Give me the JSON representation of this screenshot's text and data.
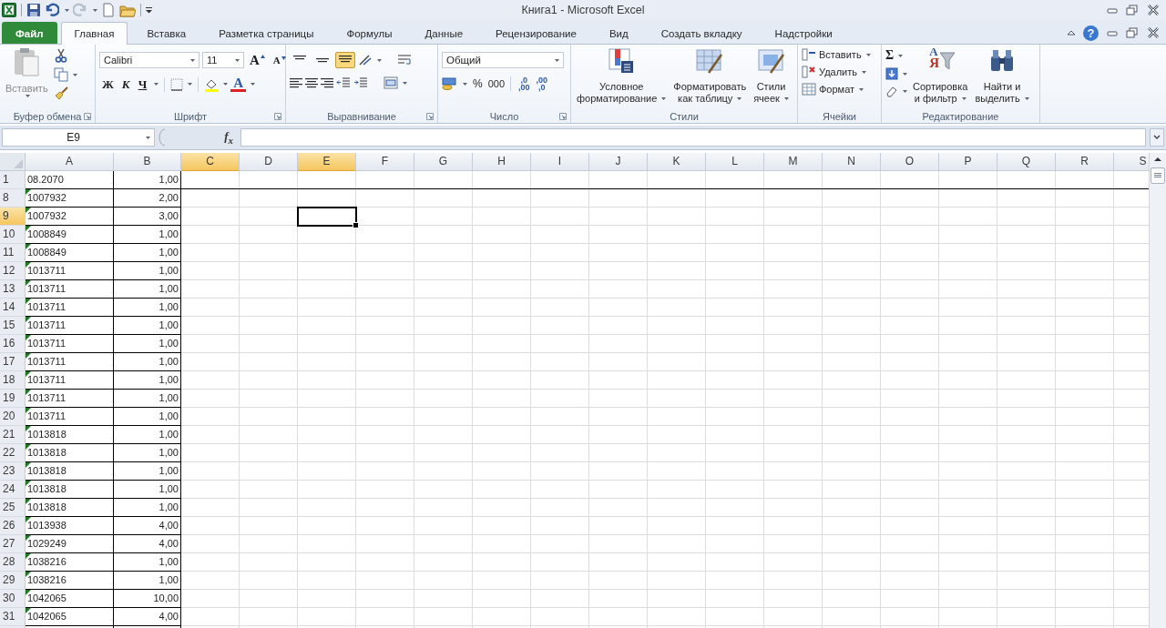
{
  "window": {
    "title": "Книга1  -  Microsoft Excel"
  },
  "tabs": [
    {
      "label": "Файл",
      "kind": "file",
      "selected": false
    },
    {
      "label": "Главная",
      "kind": "tab",
      "selected": true
    },
    {
      "label": "Вставка",
      "kind": "tab",
      "selected": false
    },
    {
      "label": "Разметка страницы",
      "kind": "tab",
      "selected": false
    },
    {
      "label": "Формулы",
      "kind": "tab",
      "selected": false
    },
    {
      "label": "Данные",
      "kind": "tab",
      "selected": false
    },
    {
      "label": "Рецензирование",
      "kind": "tab",
      "selected": false
    },
    {
      "label": "Вид",
      "kind": "tab",
      "selected": false
    },
    {
      "label": "Создать вкладку",
      "kind": "tab",
      "selected": false
    },
    {
      "label": "Надстройки",
      "kind": "tab",
      "selected": false
    }
  ],
  "help": {
    "glyph": "?"
  },
  "ribbon": [
    {
      "kind": "clipboard",
      "name": "Буфер обмена",
      "paste": "Вставить",
      "disabled": true
    },
    {
      "kind": "font",
      "name": "Шрифт",
      "font": "Calibri",
      "size": "11",
      "grow": "A",
      "shrink": "A",
      "bold": "Ж",
      "italic": "К",
      "underline": "Ч",
      "color_letter": "A"
    },
    {
      "kind": "alignment",
      "name": "Выравнивание",
      "vertical": [
        {
          "selected": false
        },
        {
          "selected": false
        },
        {
          "selected": true
        }
      ]
    },
    {
      "kind": "number",
      "name": "Число",
      "format": "Общий",
      "percent": "%",
      "thousands": "000",
      "increase_decimal": [
        ",0",
        ",00"
      ],
      "decrease_decimal": [
        ",00",
        ",0"
      ]
    },
    {
      "kind": "styles",
      "name": "Стили",
      "buttons": [
        {
          "lines": [
            "Условное",
            "форматирование"
          ]
        },
        {
          "lines": [
            "Форматировать",
            "как таблицу"
          ]
        },
        {
          "lines": [
            "Стили",
            "ячеек"
          ]
        }
      ]
    },
    {
      "kind": "cells",
      "name": "Ячейки",
      "buttons": [
        "Вставить",
        "Удалить",
        "Формат"
      ]
    },
    {
      "kind": "editing",
      "name": "Редактирование",
      "sum": "Σ",
      "sort_letters": [
        "A",
        "Я"
      ],
      "buttons": [
        {
          "lines": [
            "Сортировка",
            "и фильтр"
          ]
        },
        {
          "lines": [
            "Найти и",
            "выделить"
          ]
        }
      ]
    }
  ],
  "formula_bar": {
    "name_box": "E9",
    "fx": "f$_{x}$"
  },
  "columns": [
    {
      "label": "A",
      "selected": false,
      "active": false
    },
    {
      "label": "B",
      "selected": false,
      "active": false
    },
    {
      "label": "C",
      "selected": true,
      "active": false
    },
    {
      "label": "D",
      "selected": false,
      "active": false
    },
    {
      "label": "E",
      "selected": true,
      "active": true
    },
    {
      "label": "F",
      "selected": false,
      "active": false
    },
    {
      "label": "G",
      "selected": false,
      "active": false
    },
    {
      "label": "H",
      "selected": false,
      "active": false
    },
    {
      "label": "I",
      "selected": false,
      "active": false
    },
    {
      "label": "J",
      "selected": false,
      "active": false
    },
    {
      "label": "K",
      "selected": false,
      "active": false
    },
    {
      "label": "L",
      "selected": false,
      "active": false
    },
    {
      "label": "M",
      "selected": false,
      "active": false
    },
    {
      "label": "N",
      "selected": false,
      "active": false
    },
    {
      "label": "O",
      "selected": false,
      "active": false
    },
    {
      "label": "P",
      "selected": false,
      "active": false
    },
    {
      "label": "Q",
      "selected": false,
      "active": false
    },
    {
      "label": "R",
      "selected": false,
      "active": false
    },
    {
      "label": "S",
      "selected": false,
      "active": false
    }
  ],
  "rows": [
    {
      "number": "1",
      "selected": false,
      "a": "08.2070",
      "b": "1,00",
      "error_mark": false,
      "border_below": true
    },
    {
      "number": "8",
      "selected": false,
      "a": "1007932",
      "b": "2,00",
      "error_mark": true,
      "border_below": false
    },
    {
      "number": "9",
      "selected": true,
      "a": "1007932",
      "b": "3,00",
      "error_mark": true,
      "border_below": false
    },
    {
      "number": "10",
      "selected": false,
      "a": "1008849",
      "b": "1,00",
      "error_mark": true,
      "border_below": false
    },
    {
      "number": "11",
      "selected": false,
      "a": "1008849",
      "b": "1,00",
      "error_mark": true,
      "border_below": false
    },
    {
      "number": "12",
      "selected": false,
      "a": "1013711",
      "b": "1,00",
      "error_mark": true,
      "border_below": false
    },
    {
      "number": "13",
      "selected": false,
      "a": "1013711",
      "b": "1,00",
      "error_mark": true,
      "border_below": false
    },
    {
      "number": "14",
      "selected": false,
      "a": "1013711",
      "b": "1,00",
      "error_mark": true,
      "border_below": false
    },
    {
      "number": "15",
      "selected": false,
      "a": "1013711",
      "b": "1,00",
      "error_mark": true,
      "border_below": false
    },
    {
      "number": "16",
      "selected": false,
      "a": "1013711",
      "b": "1,00",
      "error_mark": true,
      "border_below": false
    },
    {
      "number": "17",
      "selected": false,
      "a": "1013711",
      "b": "1,00",
      "error_mark": true,
      "border_below": false
    },
    {
      "number": "18",
      "selected": false,
      "a": "1013711",
      "b": "1,00",
      "error_mark": true,
      "border_below": false
    },
    {
      "number": "19",
      "selected": false,
      "a": "1013711",
      "b": "1,00",
      "error_mark": true,
      "border_below": false
    },
    {
      "number": "20",
      "selected": false,
      "a": "1013711",
      "b": "1,00",
      "error_mark": true,
      "border_below": false
    },
    {
      "number": "21",
      "selected": false,
      "a": "1013818",
      "b": "1,00",
      "error_mark": true,
      "border_below": false
    },
    {
      "number": "22",
      "selected": false,
      "a": "1013818",
      "b": "1,00",
      "error_mark": true,
      "border_below": false
    },
    {
      "number": "23",
      "selected": false,
      "a": "1013818",
      "b": "1,00",
      "error_mark": true,
      "border_below": false
    },
    {
      "number": "24",
      "selected": false,
      "a": "1013818",
      "b": "1,00",
      "error_mark": true,
      "border_below": false
    },
    {
      "number": "25",
      "selected": false,
      "a": "1013818",
      "b": "1,00",
      "error_mark": true,
      "border_below": false
    },
    {
      "number": "26",
      "selected": false,
      "a": "1013938",
      "b": "4,00",
      "error_mark": true,
      "border_below": false
    },
    {
      "number": "27",
      "selected": false,
      "a": "1029249",
      "b": "4,00",
      "error_mark": true,
      "border_below": false
    },
    {
      "number": "28",
      "selected": false,
      "a": "1038216",
      "b": "1,00",
      "error_mark": true,
      "border_below": false
    },
    {
      "number": "29",
      "selected": false,
      "a": "1038216",
      "b": "1,00",
      "error_mark": true,
      "border_below": false
    },
    {
      "number": "30",
      "selected": false,
      "a": "1042065",
      "b": "10,00",
      "error_mark": true,
      "border_below": false
    },
    {
      "number": "31",
      "selected": false,
      "a": "1042065",
      "b": "4,00",
      "error_mark": true,
      "border_below": false
    }
  ]
}
